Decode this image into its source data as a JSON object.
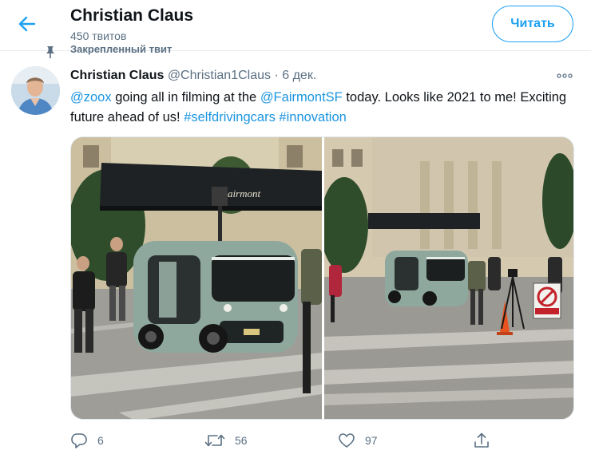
{
  "header": {
    "title": "Christian Claus",
    "tweet_count": "450 твитов",
    "follow_label": "Читать"
  },
  "pinned": {
    "label": "Закрепленный твит"
  },
  "tweet": {
    "author_name": "Christian Claus",
    "author_handle": "@Christian1Claus",
    "separator": "·",
    "date": "6 дек.",
    "text": {
      "mention1": "@zoox",
      "part1": " going all in filming at the ",
      "mention2": "@FairmontSF",
      "part2": " today. Looks like 2021 to me! Exciting future ahead of us! ",
      "hashtag1": "#selfdrivingcars",
      "hashtag2": "#innovation"
    },
    "media": {
      "left_sign": "Fairmont"
    },
    "actions": {
      "reply_count": "6",
      "retweet_count": "56",
      "like_count": "97"
    }
  },
  "colors": {
    "accent": "#1da1f2",
    "link": "#1b95e0",
    "secondary_text": "#5b7083",
    "divider": "#e6ecf0"
  },
  "icons": [
    "back-arrow-icon",
    "pin-icon",
    "more-icon",
    "reply-icon",
    "retweet-icon",
    "like-icon",
    "share-icon"
  ]
}
